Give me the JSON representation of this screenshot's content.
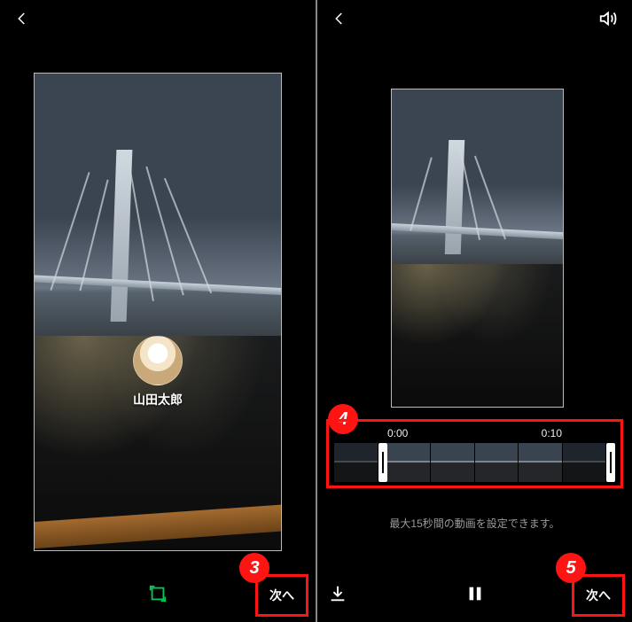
{
  "colors": {
    "annotation": "#ff1414",
    "accent_green": "#06c755"
  },
  "left_screen": {
    "profile_name": "山田太郎",
    "next_button": "次へ",
    "callout": "3"
  },
  "right_screen": {
    "trim": {
      "start": "0:00",
      "end": "0:10",
      "note": "最大15秒間の動画を設定できます。",
      "callout": "4"
    },
    "next_button": "次へ",
    "next_callout": "5"
  }
}
